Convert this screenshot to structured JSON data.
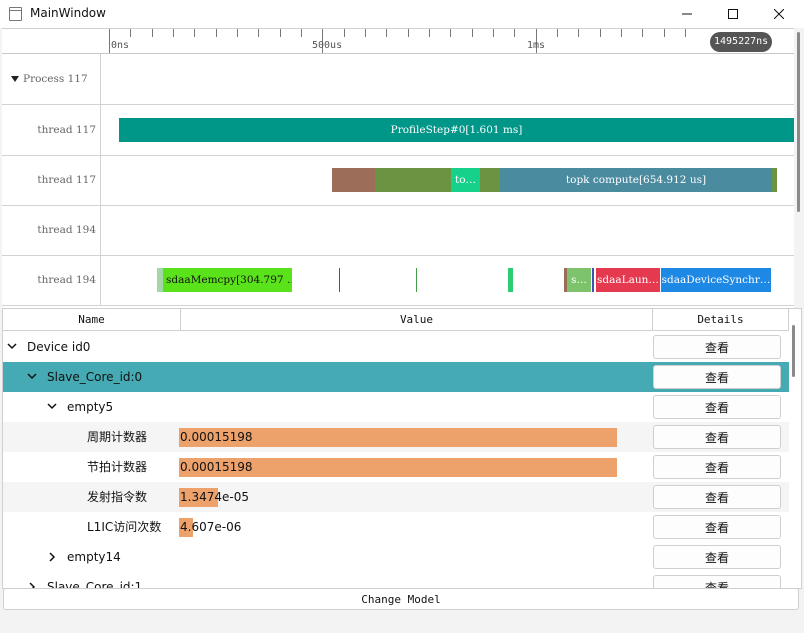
{
  "window": {
    "title": "MainWindow"
  },
  "ruler": {
    "labels": [
      "0ns",
      "500us",
      "1ms"
    ],
    "cursor_readout": "1495227ns"
  },
  "tracks": [
    {
      "label": "Process 117",
      "collapsed": false,
      "slices": []
    },
    {
      "label": "thread 117",
      "slices": [
        {
          "text": "ProfileStep#0[1.601 ms]",
          "color": "#009688"
        }
      ]
    },
    {
      "label": "thread 117",
      "slices": [
        {
          "text": "",
          "color": "#9c6d58"
        },
        {
          "text": "",
          "color": "#6a9441"
        },
        {
          "text": "to…",
          "color": "#15d18a"
        },
        {
          "text": "",
          "color": "#6a9441"
        },
        {
          "text": "topk compute[654.912 us]",
          "color": "#4b8ba0"
        },
        {
          "text": "",
          "color": "#6a9441"
        }
      ]
    },
    {
      "label": "thread 194",
      "slices": []
    },
    {
      "label": "thread 194",
      "slices": [
        {
          "text": "",
          "color": "#a5d6a7"
        },
        {
          "text": "sdaaMemcpy[304.797 …",
          "color": "#5ae21a",
          "text_color": "#111111"
        },
        {
          "text": "",
          "color": "#3f51b5"
        },
        {
          "text": "",
          "color": "#43a047"
        },
        {
          "text": "",
          "color": "#2ecc71"
        },
        {
          "text": "",
          "color": "#9c6d58"
        },
        {
          "text": "s…",
          "color": "#7dc36b"
        },
        {
          "text": "sdaaLaun…",
          "color": "#e53950"
        },
        {
          "text": "sdaaDeviceSynchr…",
          "color": "#1e88e5"
        }
      ]
    }
  ],
  "table": {
    "headers": [
      "Name",
      "Value",
      "Details"
    ],
    "details_label": "查看",
    "rows": [
      {
        "name": "Device id0",
        "expander": "expanded",
        "value": "",
        "value_fraction": null
      },
      {
        "name": "Slave_Core_id:0",
        "expander": "expanded",
        "value": "",
        "value_fraction": null,
        "selected": true
      },
      {
        "name": "empty5",
        "expander": "expanded",
        "value": "",
        "value_fraction": null
      },
      {
        "name": "周期计数器",
        "expander": "none",
        "value": "0.00015198",
        "value_fraction": 1.0
      },
      {
        "name": "节拍计数器",
        "expander": "none",
        "value": "0.00015198",
        "value_fraction": 1.0
      },
      {
        "name": "发射指令数",
        "expander": "none",
        "value": "1.3474e-05",
        "value_fraction": 0.089
      },
      {
        "name": "L1IC访问次数",
        "expander": "none",
        "value": "4.607e-06",
        "value_fraction": 0.03
      },
      {
        "name": "empty14",
        "expander": "collapsed",
        "value": "",
        "value_fraction": null
      },
      {
        "name": "Slave_Core_id:1",
        "expander": "collapsed",
        "value": "",
        "value_fraction": null
      }
    ]
  },
  "footer": {
    "button_label": "Change Model"
  }
}
